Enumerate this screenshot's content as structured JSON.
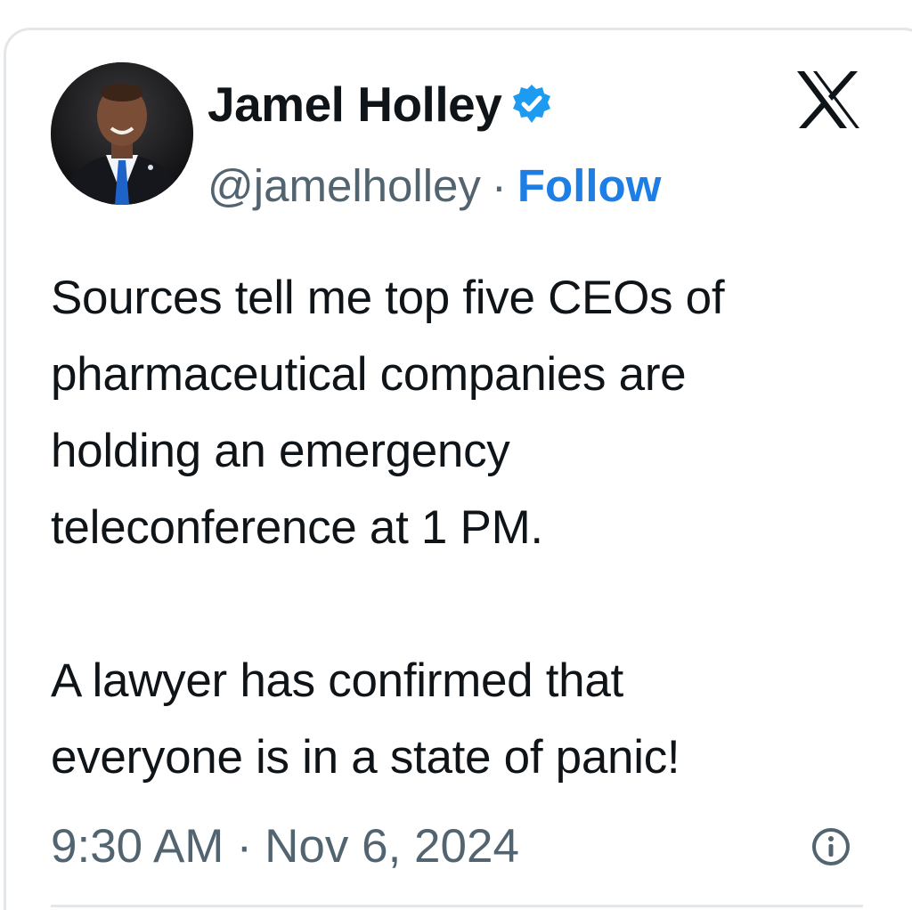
{
  "author": {
    "display_name": "Jamel Holley",
    "handle": "@jamelholley",
    "verified": true,
    "avatar_icon": "profile-photo"
  },
  "header": {
    "separator": "·",
    "follow_label": "Follow",
    "logo_icon": "x-logo-icon"
  },
  "tweet": {
    "paragraphs": [
      [
        "Sources tell me top five CEOs of",
        "pharmaceutical companies are",
        "holding an emergency",
        "teleconference at 1 PM."
      ],
      [
        "A lawyer has confirmed that",
        "everyone is in a state of panic!"
      ]
    ]
  },
  "meta": {
    "time": "9:30 AM",
    "separator": "·",
    "date": "Nov 6, 2024",
    "info_icon": "info-icon"
  },
  "colors": {
    "text": "#0f1419",
    "secondary": "#536471",
    "follow": "#1d7ee6",
    "verified": "#1d9bf0",
    "border": "#e3e7ea"
  }
}
